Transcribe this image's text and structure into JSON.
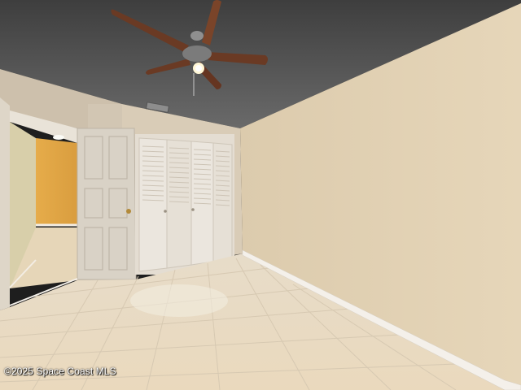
{
  "photo": {
    "subject": "empty bedroom with ceiling fan, louvered bifold closet doors and tile floor",
    "colors": {
      "ceiling": "#5b5b5b",
      "right_wall": "#dfcfb2",
      "back_wall": "#d6c9b4",
      "left_wall": "#cbbfac",
      "hallway_wall": "#e2a94c",
      "floor_tile": "#e9dcc4",
      "baseboard": "#f4f0ea",
      "door": "#d9d2c6",
      "fan_blade": "#6a3a24"
    }
  },
  "watermark": {
    "text": "©2025 Space Coast MLS"
  }
}
